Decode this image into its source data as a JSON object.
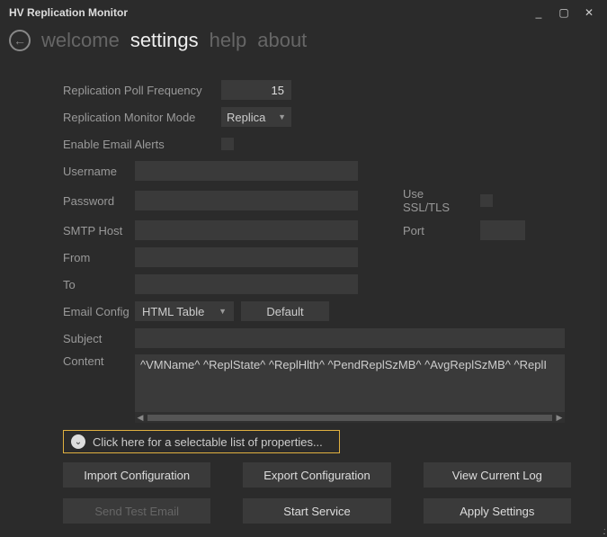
{
  "window": {
    "title": "HV Replication Monitor"
  },
  "tabs": {
    "welcome": "welcome",
    "settings": "settings",
    "help": "help",
    "about": "about"
  },
  "labels": {
    "poll": "Replication Poll Frequency",
    "mode": "Replication Monitor Mode",
    "alerts": "Enable Email Alerts",
    "username": "Username",
    "password": "Password",
    "smtp": "SMTP Host",
    "from": "From",
    "to": "To",
    "emailcfg": "Email Config",
    "subject": "Subject",
    "content": "Content",
    "usessl": "Use SSL/TLS",
    "port": "Port"
  },
  "values": {
    "poll": "15",
    "mode": "Replica",
    "emailcfg": "HTML Table",
    "content": "^VMName^ ^ReplState^ ^ReplHlth^ ^PendReplSzMB^ ^AvgReplSzMB^ ^ReplI",
    "username": "",
    "password": "",
    "smtp": "",
    "from": "",
    "to": "",
    "subject": "",
    "port": ""
  },
  "buttons": {
    "default": "Default",
    "expander": "Click here for a selectable list of properties...",
    "import": "Import Configuration",
    "export": "Export Configuration",
    "viewlog": "View Current Log",
    "sendtest": "Send Test Email",
    "startsvc": "Start Service",
    "apply": "Apply Settings"
  }
}
